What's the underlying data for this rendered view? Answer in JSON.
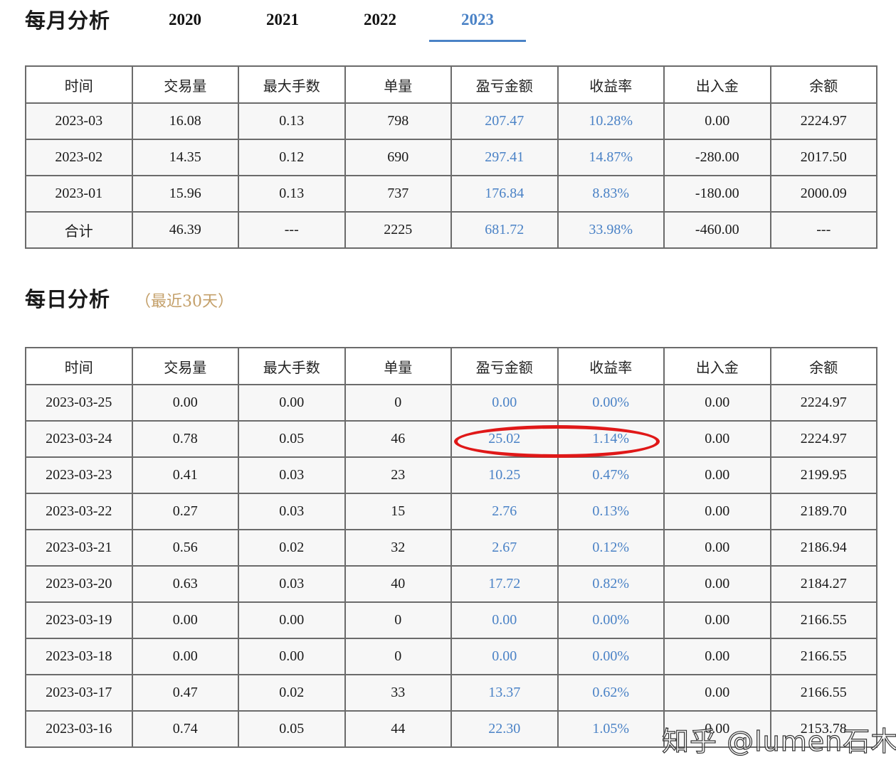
{
  "monthly": {
    "title": "每月分析",
    "tabs": [
      {
        "label": "2020",
        "active": false
      },
      {
        "label": "2021",
        "active": false
      },
      {
        "label": "2022",
        "active": false
      },
      {
        "label": "2023",
        "active": true
      }
    ],
    "headers": [
      "时间",
      "交易量",
      "最大手数",
      "单量",
      "盈亏金额",
      "收益率",
      "出入金",
      "余额"
    ],
    "rows": [
      [
        "2023-03",
        "16.08",
        "0.13",
        "798",
        "207.47",
        "10.28%",
        "0.00",
        "2224.97"
      ],
      [
        "2023-02",
        "14.35",
        "0.12",
        "690",
        "297.41",
        "14.87%",
        "-280.00",
        "2017.50"
      ],
      [
        "2023-01",
        "15.96",
        "0.13",
        "737",
        "176.84",
        "8.83%",
        "-180.00",
        "2000.09"
      ],
      [
        "合计",
        "46.39",
        "---",
        "2225",
        "681.72",
        "33.98%",
        "-460.00",
        "---"
      ]
    ]
  },
  "daily": {
    "title": "每日分析",
    "subtitle": "（最近30天）",
    "headers": [
      "时间",
      "交易量",
      "最大手数",
      "单量",
      "盈亏金额",
      "收益率",
      "出入金",
      "余额"
    ],
    "rows": [
      [
        "2023-03-25",
        "0.00",
        "0.00",
        "0",
        "0.00",
        "0.00%",
        "0.00",
        "2224.97"
      ],
      [
        "2023-03-24",
        "0.78",
        "0.05",
        "46",
        "25.02",
        "1.14%",
        "0.00",
        "2224.97"
      ],
      [
        "2023-03-23",
        "0.41",
        "0.03",
        "23",
        "10.25",
        "0.47%",
        "0.00",
        "2199.95"
      ],
      [
        "2023-03-22",
        "0.27",
        "0.03",
        "15",
        "2.76",
        "0.13%",
        "0.00",
        "2189.70"
      ],
      [
        "2023-03-21",
        "0.56",
        "0.02",
        "32",
        "2.67",
        "0.12%",
        "0.00",
        "2186.94"
      ],
      [
        "2023-03-20",
        "0.63",
        "0.03",
        "40",
        "17.72",
        "0.82%",
        "0.00",
        "2184.27"
      ],
      [
        "2023-03-19",
        "0.00",
        "0.00",
        "0",
        "0.00",
        "0.00%",
        "0.00",
        "2166.55"
      ],
      [
        "2023-03-18",
        "0.00",
        "0.00",
        "0",
        "0.00",
        "0.00%",
        "0.00",
        "2166.55"
      ],
      [
        "2023-03-17",
        "0.47",
        "0.02",
        "33",
        "13.37",
        "0.62%",
        "0.00",
        "2166.55"
      ],
      [
        "2023-03-16",
        "0.74",
        "0.05",
        "44",
        "22.30",
        "1.05%",
        "0.00",
        "2153.78"
      ]
    ]
  },
  "colors": {
    "accent": "#4a82c6",
    "subtitle": "#c4a06a",
    "highlight": "#e01818"
  },
  "watermark": "知乎 @lumen石木明"
}
